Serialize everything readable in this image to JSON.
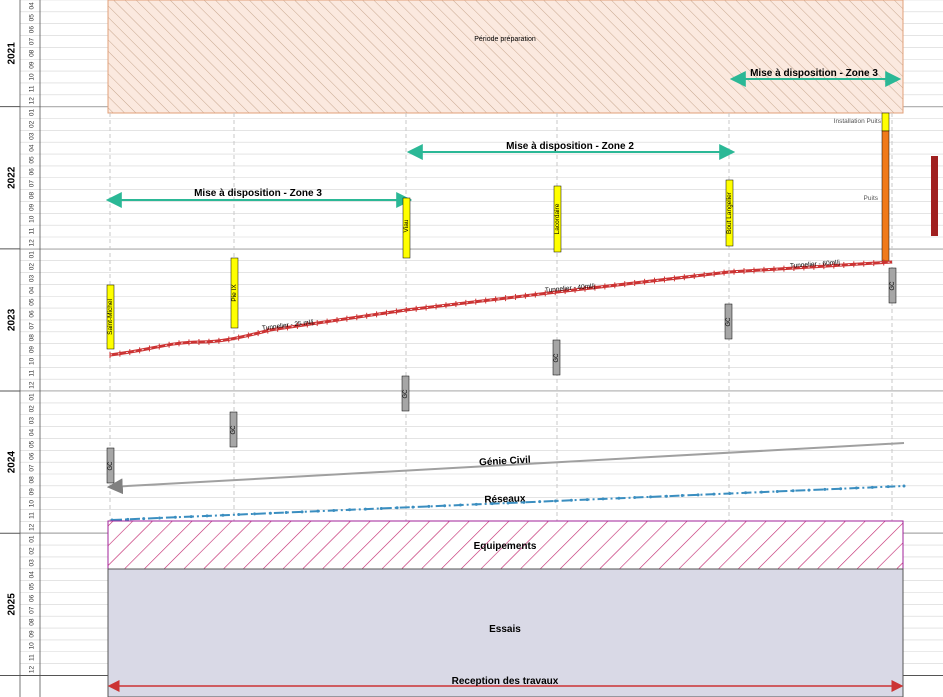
{
  "chart_data": {
    "type": "gantt",
    "years": [
      {
        "label": "2021",
        "months": [
          "04",
          "05",
          "06",
          "07",
          "08",
          "09",
          "10",
          "11",
          "12"
        ]
      },
      {
        "label": "2022",
        "months": [
          "01",
          "02",
          "03",
          "04",
          "05",
          "06",
          "07",
          "08",
          "09",
          "10",
          "11",
          "12"
        ]
      },
      {
        "label": "2023",
        "months": [
          "01",
          "02",
          "03",
          "04",
          "05",
          "06",
          "07",
          "08",
          "09",
          "10",
          "11",
          "12"
        ]
      },
      {
        "label": "2024",
        "months": [
          "01",
          "02",
          "03",
          "04",
          "05",
          "06",
          "07",
          "08",
          "09",
          "10",
          "11",
          "12"
        ]
      },
      {
        "label": "2025",
        "months": [
          "01",
          "02",
          "03",
          "04",
          "05",
          "06",
          "07",
          "08",
          "09",
          "10",
          "11",
          "12"
        ]
      }
    ],
    "phases": [
      {
        "label": "Période préparation",
        "start": "2021-04",
        "end": "2022-01",
        "fill": "#fbe9df",
        "hatch": "#c8a890",
        "border": "#e2a07a"
      },
      {
        "label": "Equipements",
        "start": "2024-10",
        "end": "2024-12",
        "fill": "#ffffff",
        "hatch": "#c0206a",
        "border": "#a0209a"
      },
      {
        "label": "Essais",
        "start": "2025-01",
        "end": "2025-12",
        "fill": "#d9d9e6",
        "border": "#555555"
      }
    ],
    "availability_arrows": [
      {
        "label": "Mise à disposition - Zone 3",
        "start": "2023-01",
        "end": "2023-01",
        "at": "2022-06",
        "color": "#2bb896"
      },
      {
        "label": "Mise à disposition - Zone 2",
        "at": "2022-03",
        "color": "#2bb896"
      },
      {
        "label": "Mise à disposition - Zone 3",
        "at": "2021-10",
        "color": "#2bb896"
      }
    ],
    "stations": [
      {
        "label": "Saint-Michel",
        "start": "2023-03",
        "end": "2023-07",
        "gc": "2024-04"
      },
      {
        "label": "Pie IX",
        "start": "2023-01",
        "end": "2023-05",
        "gc": "2024-02"
      },
      {
        "label": "Viau",
        "start": "2022-07",
        "end": "2022-12",
        "gc": "2023-12"
      },
      {
        "label": "Lacordaire",
        "start": "2022-05",
        "end": "2022-11",
        "gc": "2023-10"
      },
      {
        "label": "Bout Langelier",
        "start": "2022-04",
        "end": "2022-10",
        "gc": "2023-06"
      },
      {
        "label": "",
        "start": "",
        "end": "",
        "gc": "2023-02"
      }
    ],
    "gc_label": "GC",
    "puits": {
      "install_label": "Installation Puits",
      "label": "Puits",
      "install": [
        "2021-12",
        "2022-01"
      ],
      "shaft": [
        "2022-02",
        "2022-12"
      ]
    },
    "tunnel_labels": [
      "Tunnelier - 25 ml/j",
      "Tunnelier - 40ml/j",
      "Tunnelier - 60ml/j"
    ],
    "lines": [
      {
        "label": "Génie Civil",
        "color": "#a0a0a0"
      },
      {
        "label": "Réseaux",
        "color": "#3a8ec0"
      }
    ],
    "reception": {
      "label": "Reception des travaux",
      "color": "#cc3333"
    },
    "colors": {
      "station": "#ffff00",
      "gc_box": "#a6a6a6",
      "tunnel": "#cc3333",
      "puits_install": "#ffff00",
      "puits_shaft": "#f07a1a",
      "side_bar": "#a02020"
    }
  }
}
